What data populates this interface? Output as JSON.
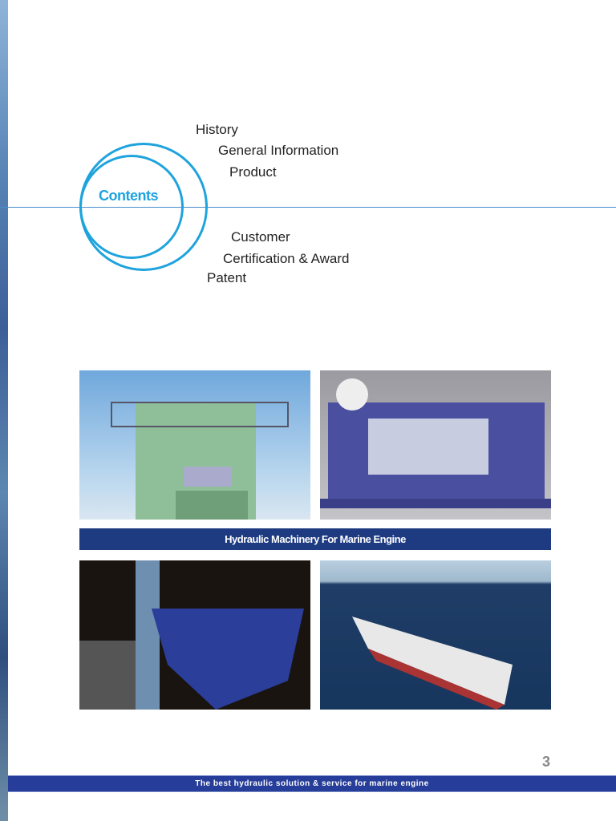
{
  "contents": {
    "title": "Contents",
    "items": [
      "History",
      "General Information",
      "Product",
      "Customer",
      "Certification & Award",
      "Patent"
    ]
  },
  "banner": "Hydraulic Machinery For Marine Engine",
  "page_number": "3",
  "footer": "The best hydraulic solution & service for marine engine",
  "colors": {
    "accent": "#1fa3dd",
    "banner": "#1e3b82",
    "footer": "#263d99"
  }
}
